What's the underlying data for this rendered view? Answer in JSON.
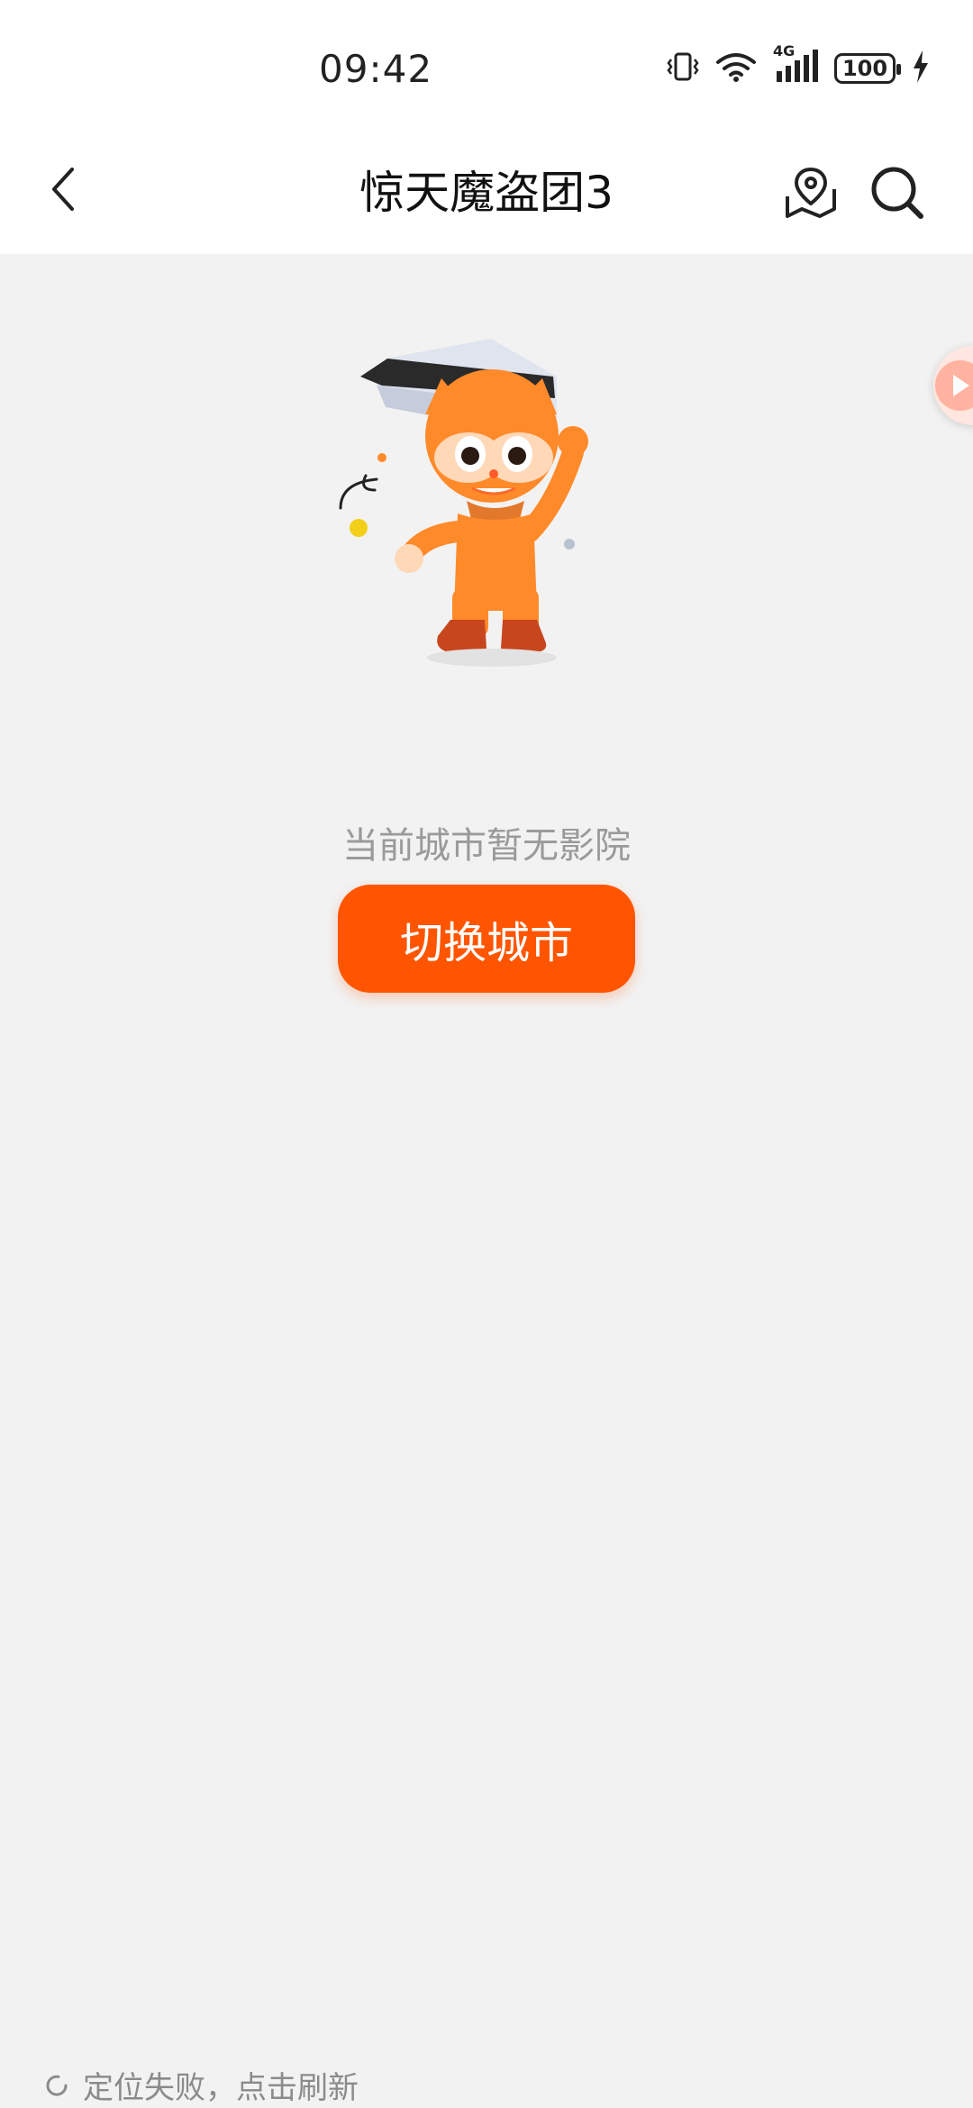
{
  "status_bar": {
    "time": "09:42",
    "network": "4G",
    "battery": "100",
    "icons": [
      "vibrate-icon",
      "wifi-icon",
      "signal-icon",
      "battery-icon",
      "charging-icon"
    ]
  },
  "header": {
    "title": "惊天魔盗团3",
    "back_icon": "chevron-left-icon",
    "map_icon": "map-location-icon",
    "search_icon": "search-icon"
  },
  "main": {
    "empty_message": "当前城市暂无影院",
    "switch_city_label": "切换城市",
    "brand_color": "#ff5500"
  },
  "footer": {
    "location_status": "定位失败，点击刷新",
    "refresh_icon": "refresh-icon"
  }
}
